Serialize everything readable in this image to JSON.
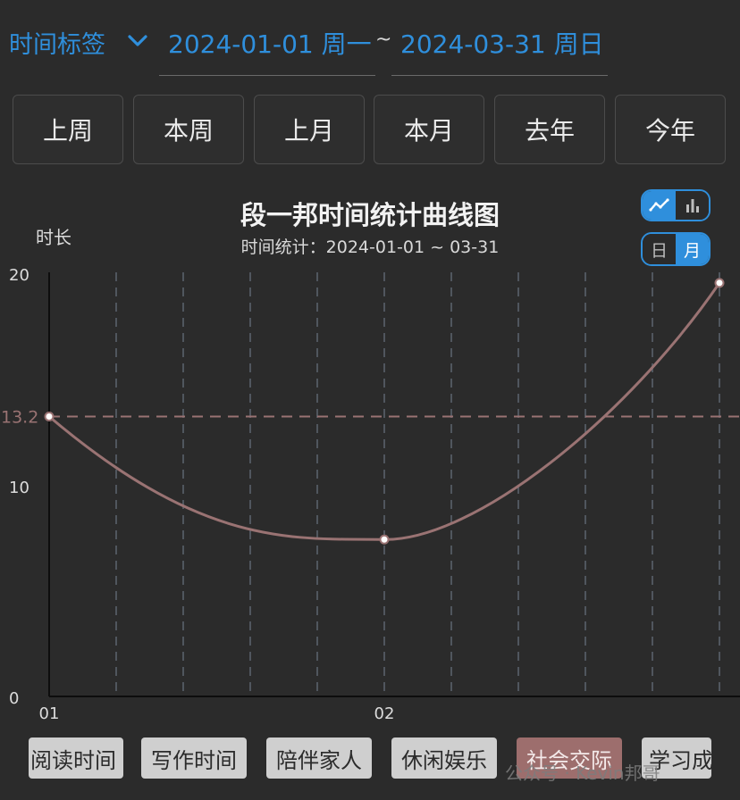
{
  "header": {
    "filter_label": "时间标签",
    "start_date": "2024-01-01 周一",
    "separator": "~",
    "end_date": "2024-03-31 周日"
  },
  "quick_ranges": [
    "上周",
    "本周",
    "上月",
    "本月",
    "去年",
    "今年"
  ],
  "chart_toggle": {
    "type_icons": [
      "line-chart-icon",
      "bar-chart-icon"
    ],
    "active_type": "line",
    "period_options": [
      "日",
      "月"
    ],
    "active_period": "月"
  },
  "chart_data": {
    "type": "line",
    "title": "段一邦时间统计曲线图",
    "subtitle": "时间统计：2024-01-01 ~ 03-31",
    "ylabel": "时长",
    "ylim": [
      0,
      20
    ],
    "yticks": [
      "0",
      "10",
      "20"
    ],
    "average": 13.2,
    "average_label": "13.2",
    "x_ticks": [
      "01",
      "02"
    ],
    "points": [
      {
        "x": "01",
        "y": 13.2
      },
      {
        "x": "02",
        "y": 7.4
      },
      {
        "x": "03",
        "y": 19.5
      }
    ],
    "line_color": "#9a7373",
    "grid": "vertical dashed",
    "legend": [
      "阅读时间",
      "写作时间",
      "陪伴家人",
      "休闲娱乐",
      "社会交际",
      "学习成长"
    ],
    "active_series": "社会交际"
  },
  "watermark": "公众号 · Kevin邦哥",
  "colors": {
    "accent": "#2f8fdc",
    "background": "#2b2b2b",
    "series": "#9a7373"
  }
}
